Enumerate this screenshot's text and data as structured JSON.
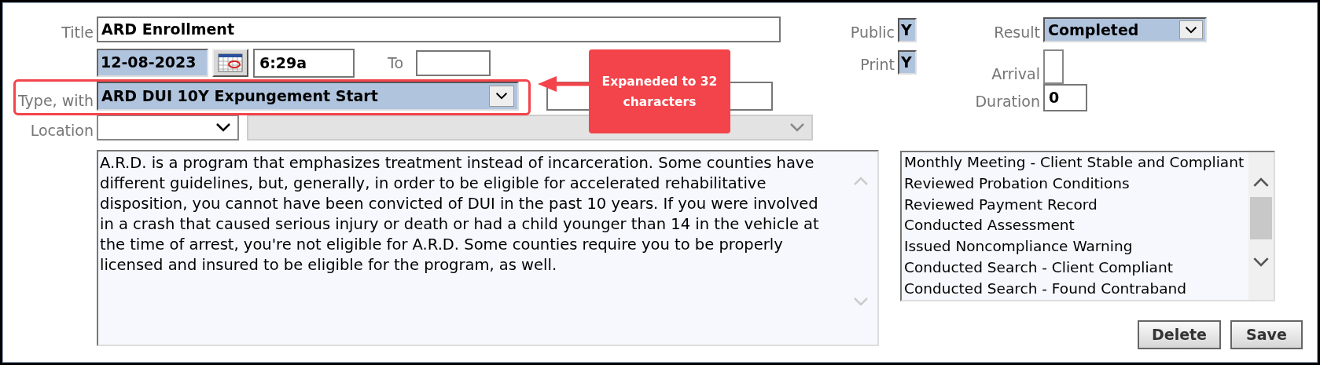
{
  "title": {
    "label": "Title",
    "value": "ARD Enrollment"
  },
  "date": {
    "value": "12-08-2023"
  },
  "start_time": {
    "value": "6:29a"
  },
  "end_time": {
    "label": "To"
  },
  "type": {
    "label": "Type, with",
    "value": "ARD DUI 10Y Expungement Start"
  },
  "location": {
    "label": "Location"
  },
  "location_detail": {
    "disabled": true
  },
  "public": {
    "label": "Public",
    "value": "Y",
    "checked": true
  },
  "print": {
    "label": "Print",
    "value": "Y",
    "checked": true
  },
  "result": {
    "label": "Result",
    "value": "Completed"
  },
  "arrival": {
    "label": "Arrival",
    "checked": false
  },
  "duration": {
    "label": "Duration",
    "value": "0"
  },
  "notes": "A.R.D. is a program that emphasizes treatment instead of incarceration. Some counties have different guidelines, but, generally, in order to be eligible for accelerated rehabilitative disposition, you cannot have been convicted of DUI in the past 10 years. If you were involved in a crash that caused serious injury or death or had a child younger than 14 in the vehicle at the time of arrest, you're not eligible for A.R.D. Some counties require you to be properly licensed and insured to be eligible for the program, as well.",
  "activities": [
    "Monthly Meeting - Client Stable and Compliant",
    "Reviewed Probation Conditions",
    "Reviewed Payment Record",
    "Conducted Assessment",
    "Issued Noncompliance Warning",
    "Conducted Search - Client Compliant",
    "Conducted Search - Found Contraband"
  ],
  "buttons": [
    "Delete",
    "Save"
  ],
  "annotation": {
    "text": "Expaneded to 32 characters"
  }
}
